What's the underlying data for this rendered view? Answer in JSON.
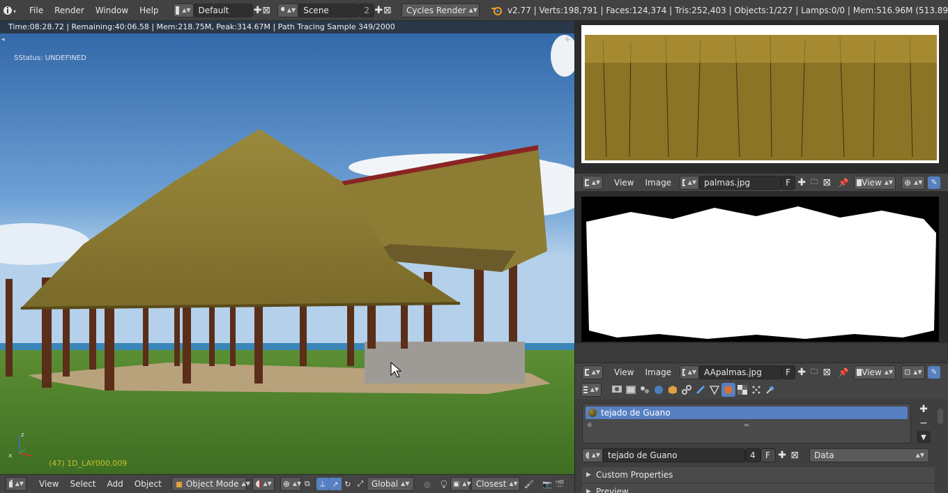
{
  "topbar": {
    "menus": [
      "File",
      "Render",
      "Window",
      "Help"
    ],
    "screen_layout": "Default",
    "scene": "Scene",
    "scene_users": "2",
    "render_engine": "Cycles Render",
    "stats": "v2.77 | Verts:198,791 | Faces:124,374 | Tris:252,403 | Objects:1/227 | Lamps:0/0 | Mem:516.96M (513.89"
  },
  "viewport": {
    "render_status": "Time:08:28.72 | Remaining:40:06.58 | Mem:218.75M, Peak:314.67M | Path Tracing Sample 349/2000",
    "sstatus": "SStatus: UNDEFINED",
    "object_label": "(47) 1D_LAY000.009",
    "header": {
      "view": "View",
      "select": "Select",
      "add": "Add",
      "object": "Object",
      "mode": "Object Mode",
      "orientation": "Global",
      "snap": "Closest"
    }
  },
  "image_editor_top": {
    "view": "View",
    "image": "Image",
    "image_name": "palmas.jpg",
    "fake_user": "F",
    "display_view": "View"
  },
  "image_editor_bottom": {
    "view": "View",
    "image": "Image",
    "image_name": "AApalmas.jpg",
    "fake_user": "F",
    "display_view": "View"
  },
  "properties": {
    "material_slot": "tejado de Guano",
    "material_name": "tejado de Guano",
    "material_users": "4",
    "fake_user": "F",
    "link": "Data",
    "panels": [
      "Custom Properties",
      "Preview"
    ]
  }
}
